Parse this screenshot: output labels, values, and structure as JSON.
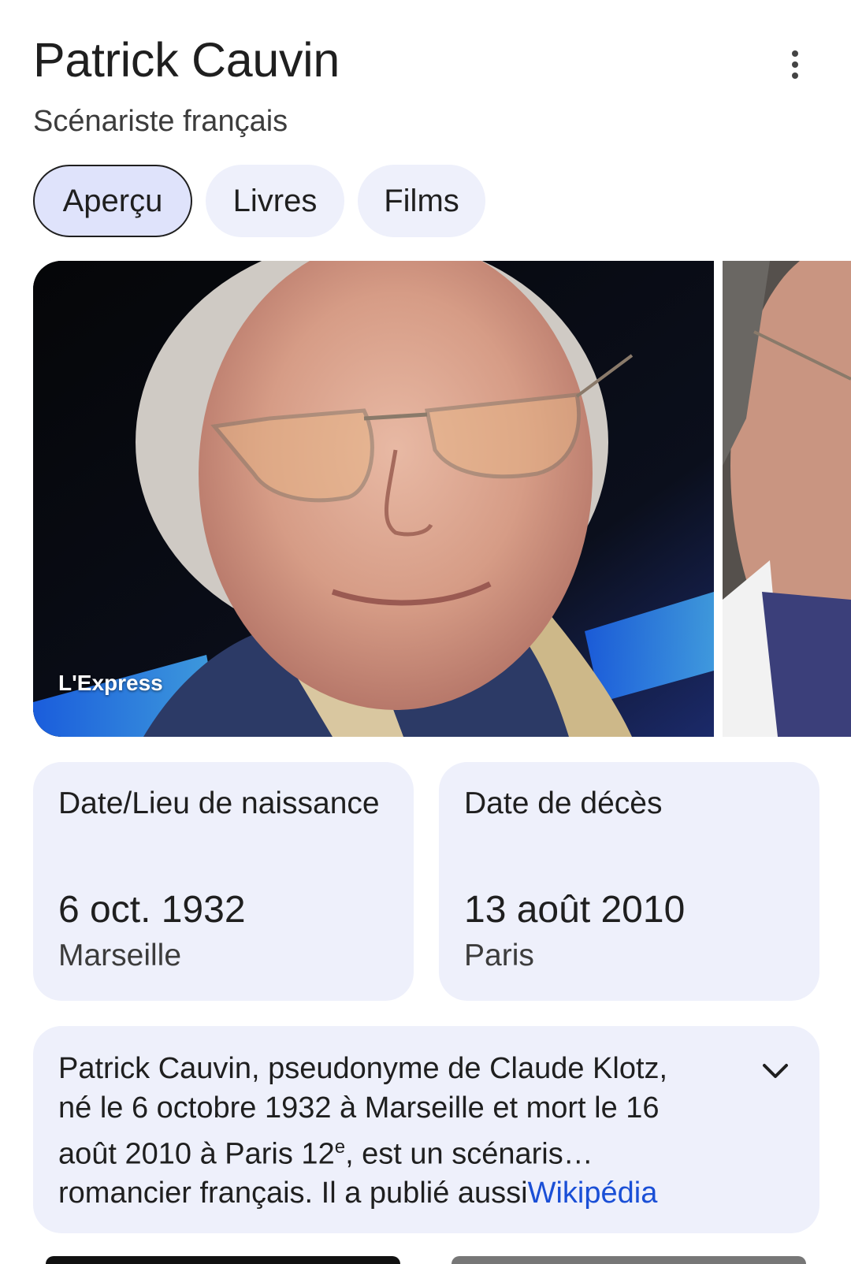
{
  "header": {
    "title": "Patrick Cauvin",
    "subtitle": "Scénariste français"
  },
  "tabs": [
    {
      "label": "Aperçu",
      "active": true
    },
    {
      "label": "Livres",
      "active": false
    },
    {
      "label": "Films",
      "active": false
    }
  ],
  "images": {
    "main_source": "L'Express"
  },
  "facts": [
    {
      "label": "Date/Lieu de naissance",
      "date": "6 oct. 1932",
      "place": "Marseille"
    },
    {
      "label": "Date de décès",
      "date": "13 août 2010",
      "place": "Paris"
    }
  ],
  "description": {
    "line1": "Patrick Cauvin, pseudonyme de Claude Klotz,",
    "line2": "né le 6 octobre 1932 à Marseille et mort le 16",
    "line3_a": "août 2010 à Paris 12",
    "line3_sup": "e",
    "line3_b": ", est un scénari",
    "line3_fade": "s…",
    "line4": "romancier français. Il a publié aussi",
    "source_link": "Wikipédia"
  },
  "colors": {
    "chip_bg": "#eef0fb",
    "chip_active_bg": "#dfe3fb",
    "card_bg": "#eef0fb",
    "link": "#1a4fd6"
  },
  "icons": {
    "menu": "more-vert-icon",
    "expand": "chevron-down-icon"
  }
}
